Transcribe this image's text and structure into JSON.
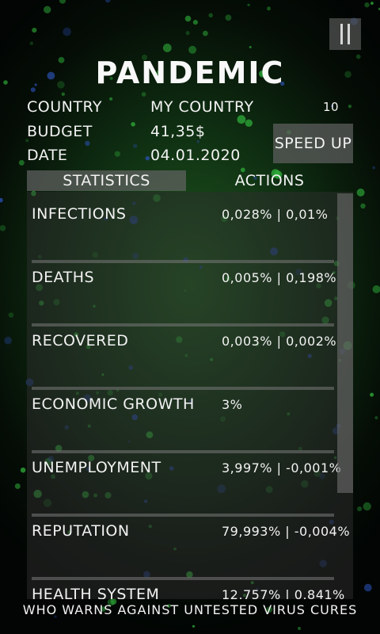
{
  "title": "PANDEMIC",
  "info": {
    "country_label": "COUNTRY",
    "country_value": "MY COUNTRY",
    "budget_label": "BUDGET",
    "budget_value": "41,35$",
    "date_label": "DATE",
    "date_value": "04.01.2020"
  },
  "speed": {
    "counter": "10",
    "button_label": "SPEED UP"
  },
  "tabs": [
    {
      "label": "STATISTICS",
      "active": true
    },
    {
      "label": "ACTIONS",
      "active": false
    }
  ],
  "statistics": [
    {
      "label": "INFECTIONS",
      "value": "0,028% | 0,01%"
    },
    {
      "label": "DEATHS",
      "value": "0,005% | 0,198%"
    },
    {
      "label": "RECOVERED",
      "value": "0,003% | 0,002%"
    },
    {
      "label": "ECONOMIC GROWTH",
      "value": "3%"
    },
    {
      "label": "UNEMPLOYMENT",
      "value": "3,997% | -0,001%"
    },
    {
      "label": "REPUTATION",
      "value": "79,993% | -0,004%"
    },
    {
      "label": "HEALTH SYSTEM",
      "value": "12,757% | 0,841%"
    }
  ],
  "ticker": "WHO WARNS AGAINST UNTESTED VIRUS CURES",
  "colors": {
    "background_center": "#1f5a1f",
    "background_edge": "#020503",
    "particle_green": "#2fae3a",
    "particle_blue": "#2a4fb0",
    "text": "#f2f2f2"
  },
  "icons": {
    "pause": "pause-icon"
  }
}
